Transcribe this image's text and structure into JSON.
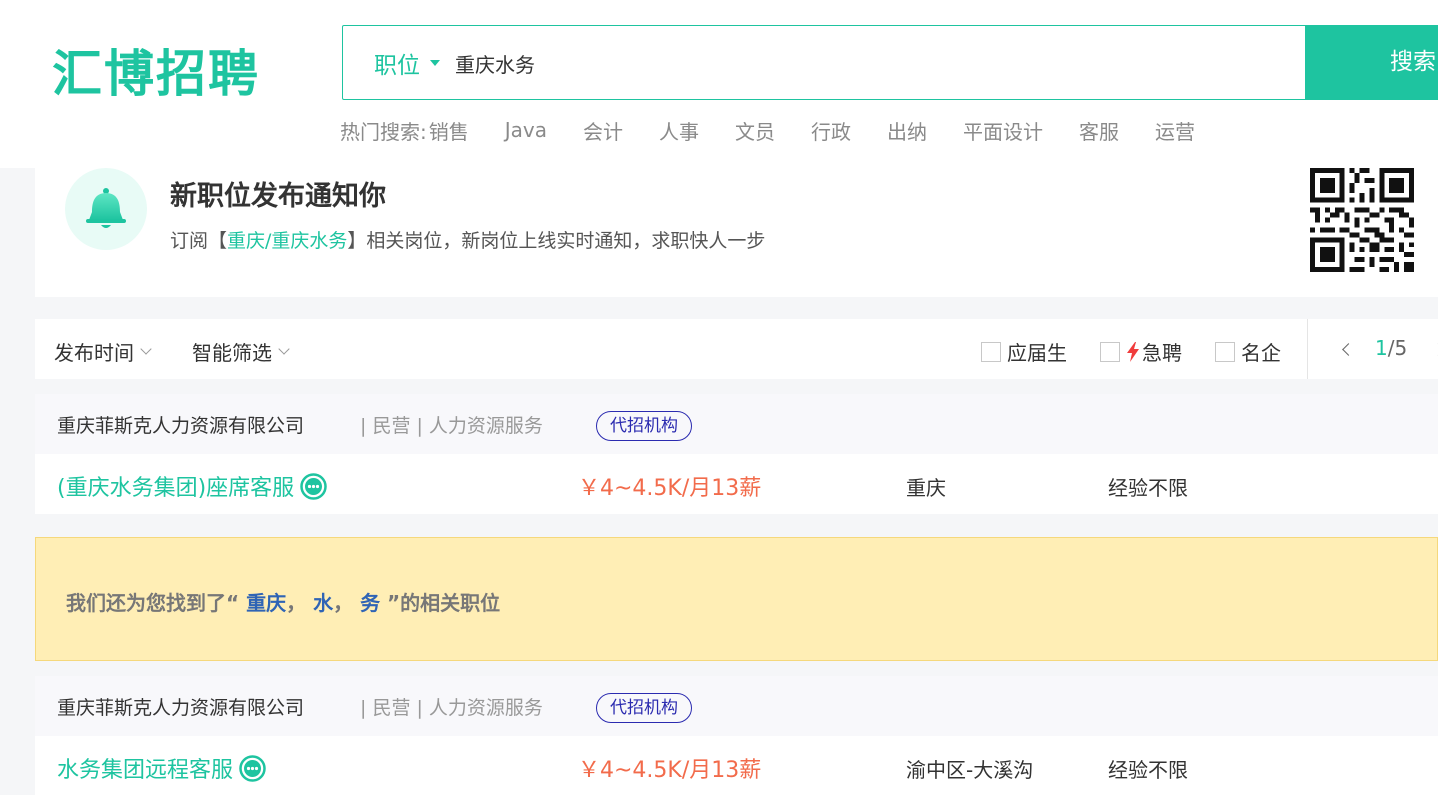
{
  "header": {
    "logo": "汇博招聘",
    "search": {
      "type_label": "职位",
      "value": "重庆水务",
      "button": "搜索"
    },
    "hot": {
      "label": "热门搜索:",
      "keywords": [
        "销售",
        "Java",
        "会计",
        "人事",
        "文员",
        "行政",
        "出纳",
        "平面设计",
        "客服",
        "运营"
      ]
    }
  },
  "notify": {
    "title": "新职位发布通知你",
    "desc_prefix": "订阅【",
    "desc_highlight": "重庆/重庆水务",
    "desc_suffix": "】相关岗位，新岗位上线实时通知，求职快人一步",
    "icon": "bell-icon"
  },
  "filter": {
    "sort": "发布时间",
    "smart": "智能筛选",
    "checkboxes": {
      "graduate": "应届生",
      "urgent": "急聘",
      "famous": "名企"
    },
    "pager": {
      "current": "1",
      "total": "/5"
    }
  },
  "jobs": [
    {
      "company": "重庆菲斯克人力资源有限公司",
      "meta": "| 民营 | 人力资源服务",
      "tag": "代招机构",
      "title": "(重庆水务集团)座席客服",
      "salary": "￥4~4.5K/月13薪",
      "location": "重庆",
      "experience": "经验不限"
    },
    {
      "company": "重庆菲斯克人力资源有限公司",
      "meta": "| 民营 | 人力资源服务",
      "tag": "代招机构",
      "title": "水务集团远程客服",
      "salary": "￥4~4.5K/月13薪",
      "location": "渝中区-大溪沟",
      "experience": "经验不限"
    }
  ],
  "related": {
    "prefix": "我们还为您找到了“",
    "kw1": "重庆",
    "sep1": "，",
    "kw2": "水",
    "sep2": "，",
    "kw3": "务",
    "suffix": "”的相关职位"
  },
  "colors": {
    "brand": "#1ec4a0",
    "salary": "#f26b4b",
    "tag": "#2b2bb0",
    "banner": "#ffeeb5"
  }
}
